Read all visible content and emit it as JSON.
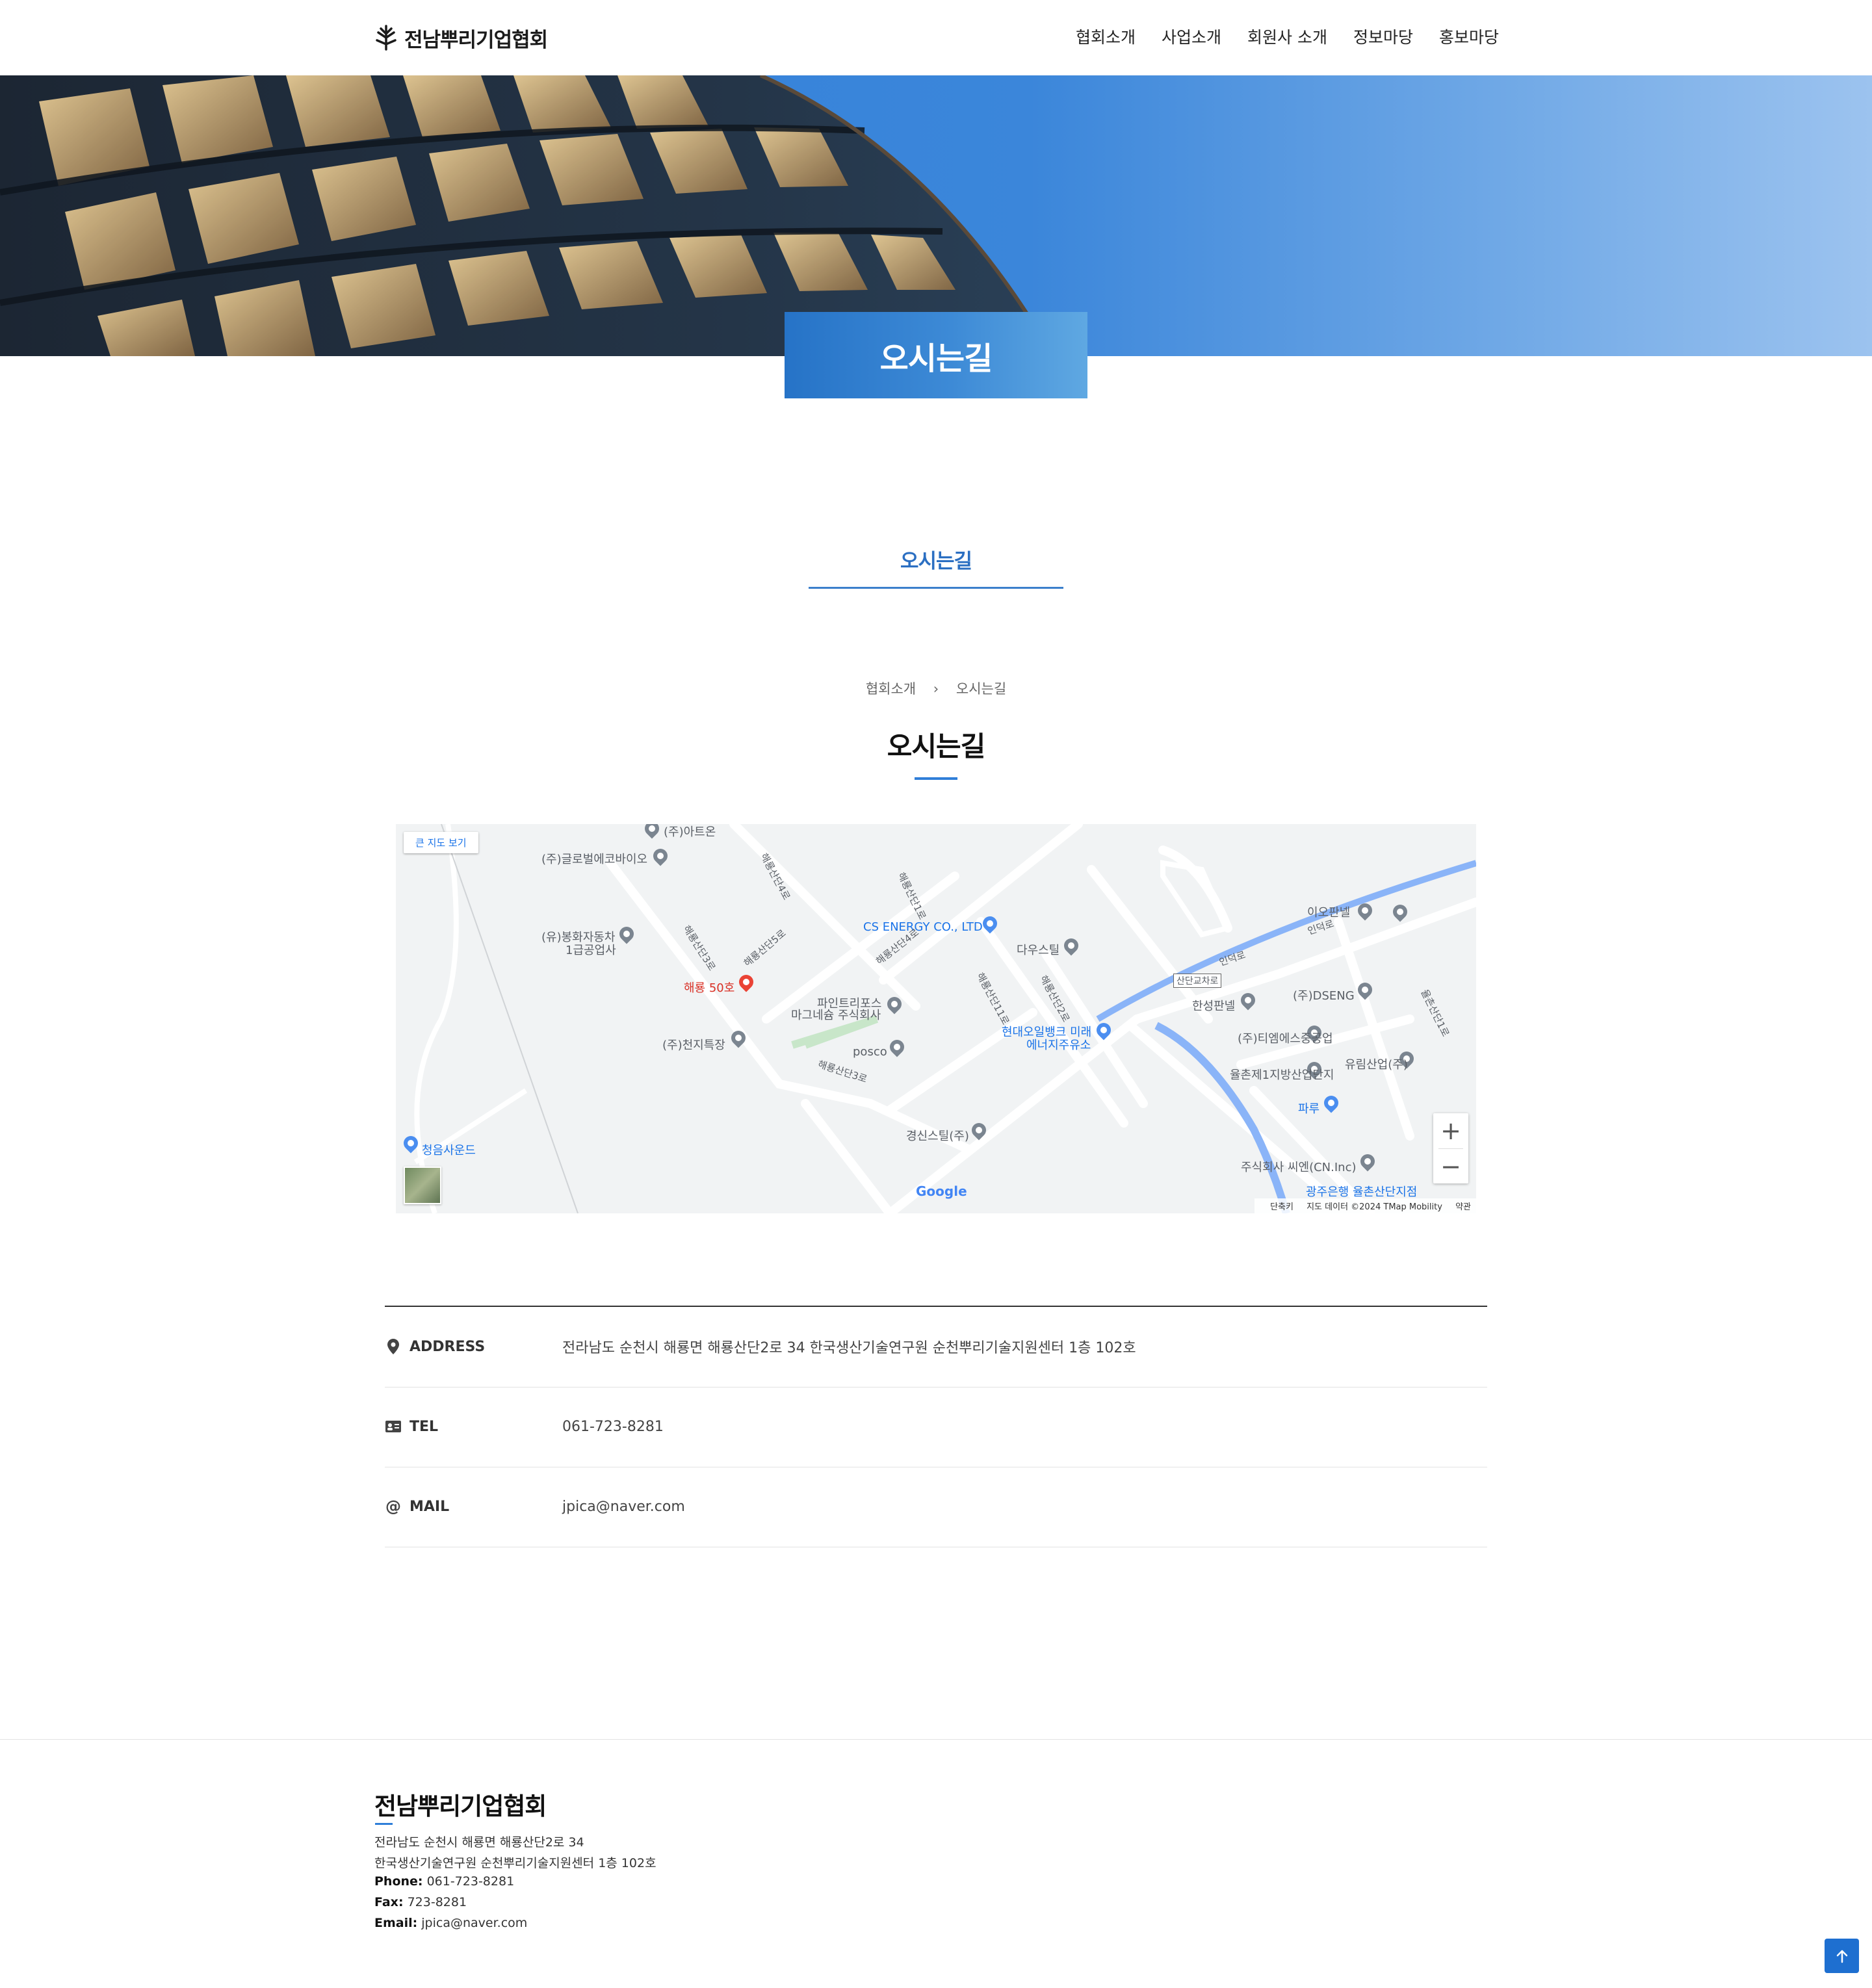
{
  "header": {
    "logo_text": "전남뿌리기업협회",
    "nav": [
      "협회소개",
      "사업소개",
      "회원사 소개",
      "정보마당",
      "홍보마당"
    ]
  },
  "hero": {
    "title": "오시는길"
  },
  "section_tab": {
    "label": "오시는길"
  },
  "breadcrumb": {
    "parent": "협회소개",
    "separator": "›",
    "current": "오시는길"
  },
  "page_title": "오시는길",
  "map": {
    "big_map_button": "큰 지도 보기",
    "places": {
      "p1": "(주)아트온",
      "p2": "(주)글로벌에코바이오",
      "p3": "(유)봉화자동차",
      "p3b": "1급공업사",
      "p4": "해룡 50호",
      "p5": "CS ENERGY CO., LTD",
      "p6": "다우스틸",
      "p7": "파인트리포스",
      "p7b": "마그네슘 주식회사",
      "p8": "(주)천지특장",
      "p9": "posco",
      "p10": "현대오일뱅크 미래",
      "p10b": "에너지주유소",
      "p11": "경신스틸(주)",
      "p12": "청음사운드",
      "p13": "이오판넬",
      "p14": "(주)DSENG",
      "p15": "한성판넬",
      "p16": "(주)티엠에스중공업",
      "p17": "율촌제1지방산업단지",
      "p18": "유림산업(주)",
      "p19": "파루",
      "p20": "주식회사 씨엔(CN.Inc)",
      "p21": "광주은행 율촌산단지점",
      "p22": "산단교차로"
    },
    "roads": {
      "r1": "해룡산단4로",
      "r2": "해룡산단1로",
      "r3": "해룡산단3로",
      "r4": "해룡산단5로",
      "r5": "해룡산단4로",
      "r6": "해룡산단11로",
      "r7": "해룡산단2로",
      "r8": "해룡산단3로",
      "r9": "인덕로",
      "r10": "인덕로",
      "r11": "율촌산단1로"
    },
    "google": "Google",
    "attribution": {
      "keys": "단축키",
      "data": "지도 데이터 ©2024 TMap Mobility",
      "terms": "약관"
    }
  },
  "info": [
    {
      "key": "ADDRESS",
      "icon": "map-marker-icon",
      "value": "전라남도 순천시 해룡면 해룡산단2로 34 한국생산기술연구원 순천뿌리기술지원센터 1층 102호"
    },
    {
      "key": "TEL",
      "icon": "contact-card-icon",
      "value": "061-723-8281"
    },
    {
      "key": "MAIL",
      "icon": "at-sign-icon",
      "value": "jpica@naver.com"
    }
  ],
  "footer": {
    "name": "전남뿌리기업협회",
    "address1": "전라남도 순천시 해룡면 해룡산단2로 34",
    "address2": "한국생산기술연구원 순천뿌리기술지원센터 1층 102호",
    "phone_label": "Phone:",
    "phone": "061-723-8281",
    "fax_label": "Fax:",
    "fax": "723-8281",
    "email_label": "Email:",
    "email": "jpica@naver.com"
  },
  "colors": {
    "accent": "#2f7ed8",
    "hero_blue": "#3b86da",
    "title_blue": "#2b6fc2"
  }
}
